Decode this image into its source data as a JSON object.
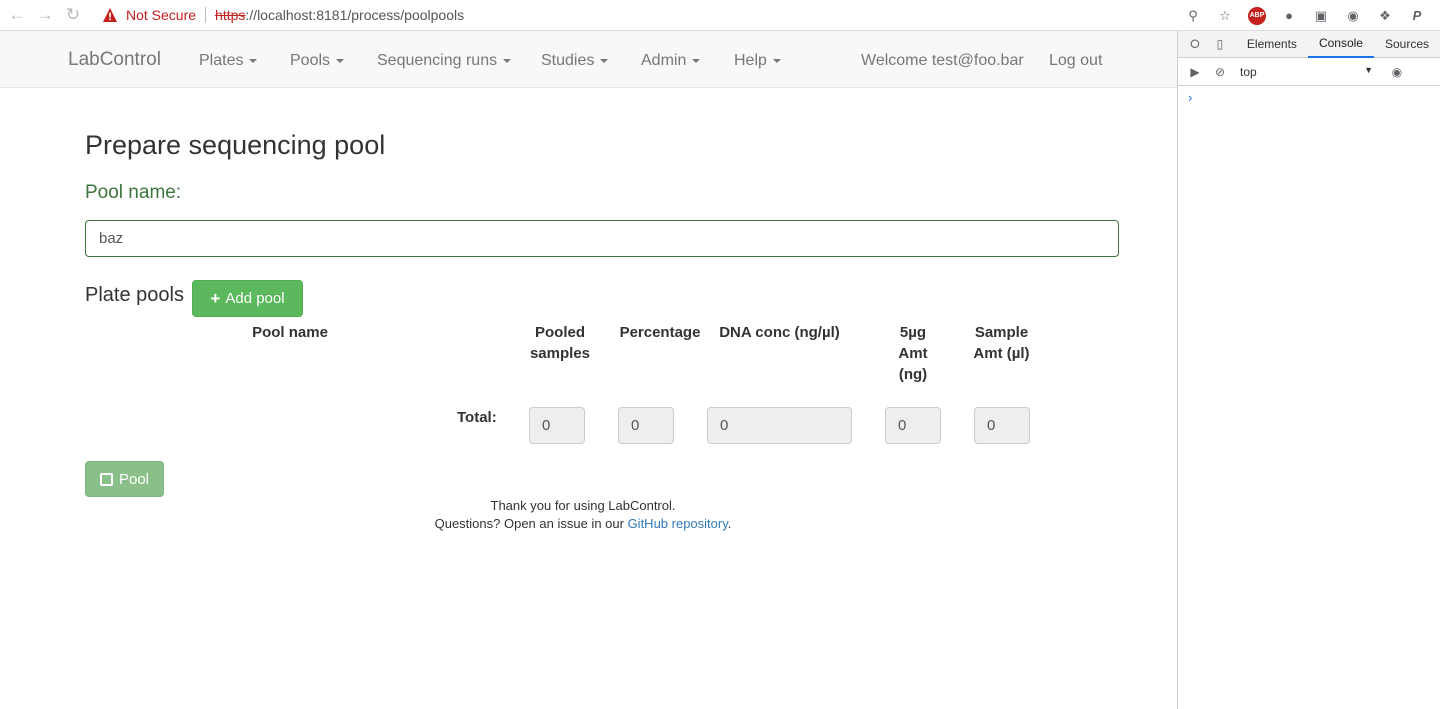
{
  "browser": {
    "not_secure": "Not Secure",
    "url_scheme": "https",
    "url_rest": "://localhost:8181/process/poolpools",
    "extensions": [
      "zoom-icon",
      "star-icon",
      "adblock-icon",
      "circle-icon",
      "window-icon",
      "pocket-icon",
      "puzzle-icon",
      "paypal-icon"
    ],
    "abp_label": "ABP"
  },
  "navbar": {
    "brand": "LabControl",
    "menus": [
      "Plates",
      "Pools",
      "Sequencing runs",
      "Studies",
      "Admin",
      "Help"
    ],
    "welcome": "Welcome test@foo.bar",
    "logout": "Log out"
  },
  "main": {
    "title": "Prepare sequencing pool",
    "pool_name_label": "Pool name:",
    "pool_name_value": "baz",
    "plate_pools_label": "Plate pools",
    "add_pool_label": "Add pool",
    "columns": {
      "pool_name": "Pool name",
      "pooled_samples": "Pooled samples",
      "percentage": "Percentage",
      "dna_conc": "DNA conc (ng/µl)",
      "amt_5ug": "5µg Amt (ng)",
      "sample_amt": "Sample Amt (µl)"
    },
    "total_label": "Total:",
    "totals": {
      "pooled_samples": "0",
      "percentage": "0",
      "dna_conc": "0",
      "amt_5ug": "0",
      "sample_amt": "0"
    },
    "pool_button": "Pool"
  },
  "footer": {
    "line1": "Thank you for using LabControl.",
    "line2_prefix": "Questions? Open an issue in our ",
    "link": "GitHub repository",
    "line2_suffix": "."
  },
  "devtools": {
    "tabs": [
      "Elements",
      "Console",
      "Sources"
    ],
    "active_tab": "Console",
    "context": "top",
    "prompt": "›"
  },
  "colors": {
    "success": "#5cb85c",
    "label_green": "#3c763d",
    "link": "#337ab7",
    "warning_red": "#c5221f"
  }
}
